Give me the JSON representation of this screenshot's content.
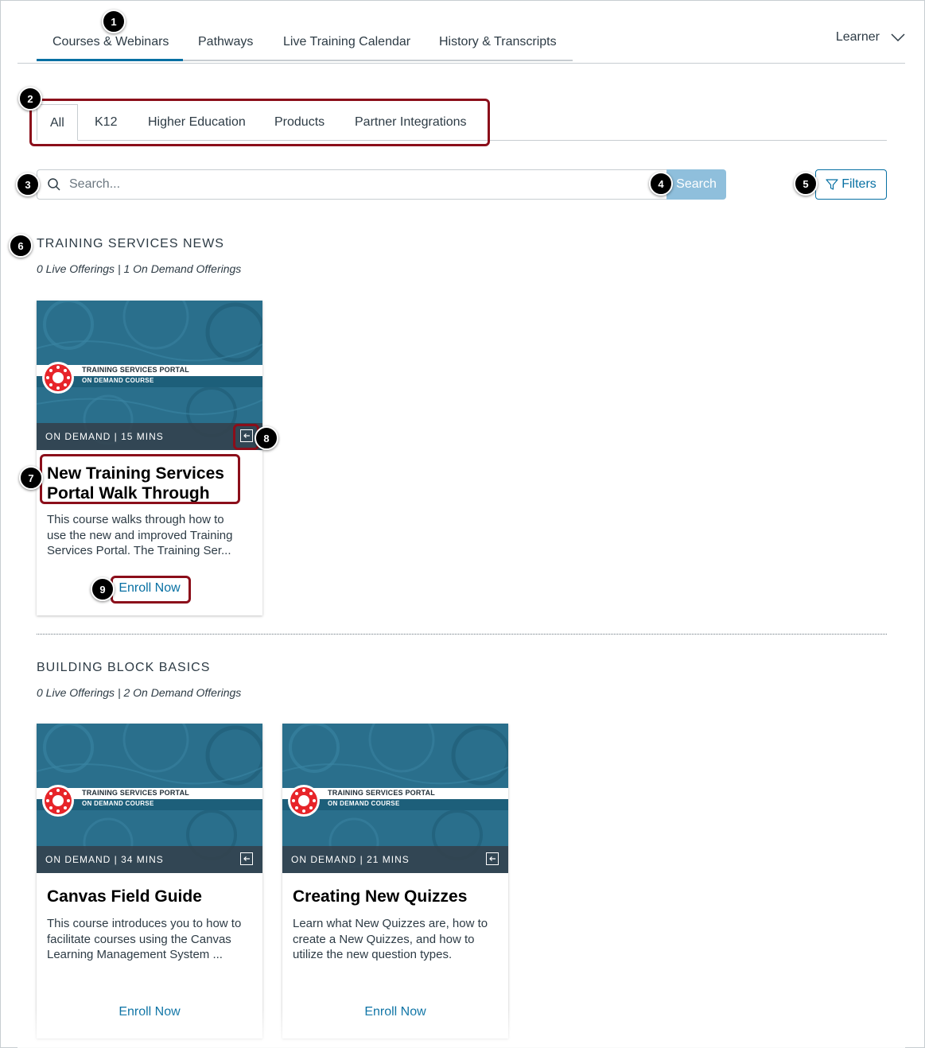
{
  "nav": {
    "tabs": [
      "Courses & Webinars",
      "Pathways",
      "Live Training Calendar",
      "History & Transcripts"
    ],
    "role": "Learner"
  },
  "categories": [
    "All",
    "K12",
    "Higher Education",
    "Products",
    "Partner Integrations"
  ],
  "search": {
    "placeholder": "Search...",
    "button": "Search",
    "filters": "Filters"
  },
  "sections": [
    {
      "title": "TRAINING SERVICES NEWS",
      "subtitle": "0 Live Offerings | 1 On Demand Offerings",
      "courses": [
        {
          "banner_line1": "TRAINING SERVICES PORTAL",
          "banner_line2": "ON DEMAND COURSE",
          "meta": "ON DEMAND | 15 MINS",
          "title_line1": "New Training Services",
          "title_line2": "Portal Walk Through",
          "desc": [
            "This course walks through how to",
            "use the new and improved Training",
            "Services Portal. The Training Ser..."
          ],
          "action": "Enroll Now"
        }
      ]
    },
    {
      "title": "BUILDING BLOCK BASICS",
      "subtitle": "0 Live Offerings | 2 On Demand Offerings",
      "courses": [
        {
          "banner_line1": "TRAINING SERVICES PORTAL",
          "banner_line2": "ON DEMAND COURSE",
          "meta": "ON DEMAND | 34 MINS",
          "title_line1": "Canvas Field Guide",
          "desc": [
            "This course introduces you to how to",
            "facilitate courses using the Canvas",
            "Learning Management System ..."
          ],
          "action": "Enroll Now"
        },
        {
          "banner_line1": "TRAINING SERVICES PORTAL",
          "banner_line2": "ON DEMAND COURSE",
          "meta": "ON DEMAND | 21 MINS",
          "title_line1": "Creating New Quizzes",
          "desc": [
            "Learn what New Quizzes are, how to",
            "create a New Quizzes, and how to",
            "utilize the new question types."
          ],
          "action": "Enroll Now"
        }
      ]
    }
  ],
  "callouts": [
    "1",
    "2",
    "3",
    "4",
    "5",
    "6",
    "7",
    "8",
    "9"
  ],
  "colors": {
    "accent": "#0770a3",
    "search_button": "#8fbfdc",
    "highlight": "#8b0e1a",
    "card_image": "#2a6f8c"
  }
}
